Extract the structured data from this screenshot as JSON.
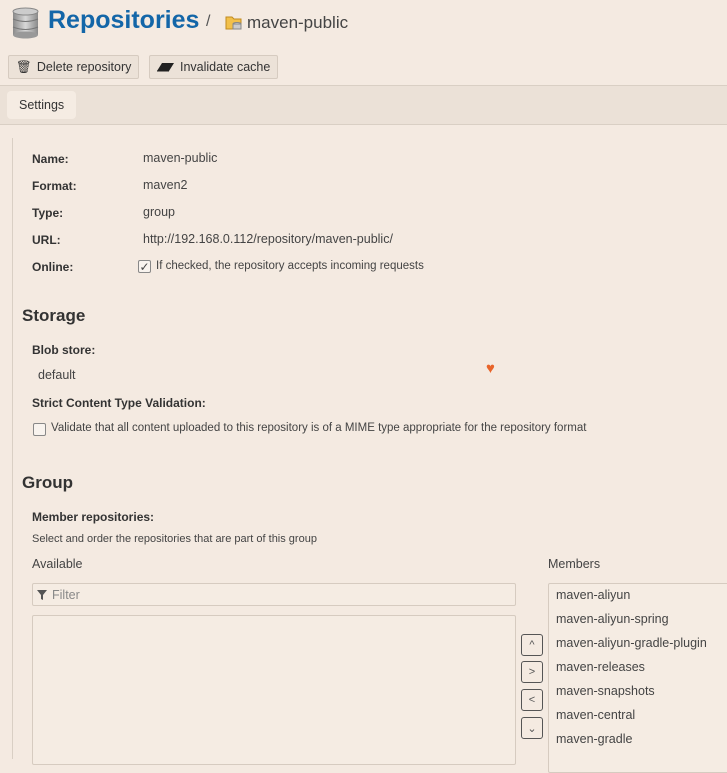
{
  "header": {
    "title": "Repositories",
    "separator": "/",
    "repo_name": "maven-public"
  },
  "toolbar": {
    "delete_label": "Delete repository",
    "invalidate_label": "Invalidate cache"
  },
  "tabs": [
    {
      "label": "Settings",
      "active": true
    }
  ],
  "details": {
    "name_label": "Name:",
    "name": "maven-public",
    "format_label": "Format:",
    "format": "maven2",
    "type_label": "Type:",
    "type": "group",
    "url_label": "URL:",
    "url": "http://192.168.0.112/repository/maven-public/",
    "online_label": "Online:",
    "online_checked": true,
    "online_text": "If checked, the repository accepts incoming requests"
  },
  "storage": {
    "heading": "Storage",
    "blob_label": "Blob store:",
    "blob_value": "default",
    "strict_label": "Strict Content Type Validation:",
    "strict_checked": false,
    "strict_text": "Validate that all content uploaded to this repository is of a MIME type appropriate for the repository format"
  },
  "group": {
    "heading": "Group",
    "member_label": "Member repositories:",
    "help": "Select and order the repositories that are part of this group",
    "available_label": "Available",
    "filter_placeholder": "Filter",
    "members_label": "Members",
    "members": [
      "maven-aliyun",
      "maven-aliyun-spring",
      "maven-aliyun-gradle-plugin",
      "maven-releases",
      "maven-snapshots",
      "maven-central",
      "maven-gradle"
    ]
  },
  "colors": {
    "title": "#1366a8",
    "background": "#f4eae1",
    "heart": "#e8642a"
  }
}
